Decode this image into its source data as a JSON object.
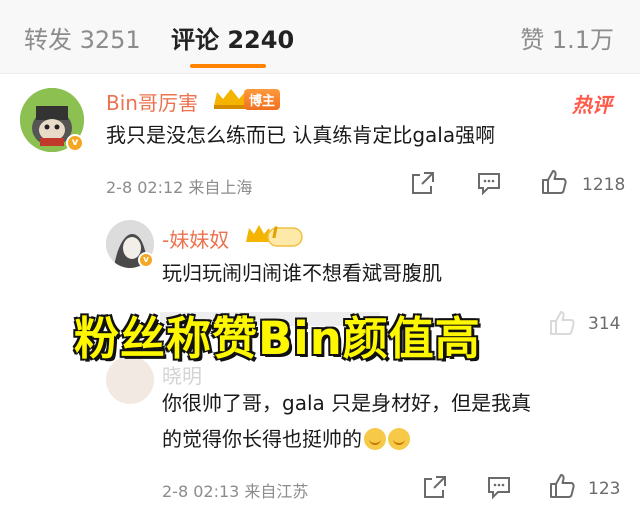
{
  "tabs": {
    "repost": "转发 3251",
    "comment": "评论 2240",
    "like": "赞 1.1万"
  },
  "comments": [
    {
      "user": "Bin哥厉害",
      "host_tag": "博主",
      "hot_tag": "热评",
      "text": "我只是没怎么练而已 认真练肯定比gala强啊",
      "time_location": "2-8 02:12 来自上海",
      "likes": "1218"
    },
    {
      "user": "-妹妹奴",
      "vip_level": "I",
      "text": "玩归玩闹归闹谁不想看斌哥腹肌",
      "likes": "314"
    },
    {
      "user": "晓明",
      "text_line1": "你很帅了哥，gala 只是身材好，但是我真",
      "text_line2": "的觉得你长得也挺帅的",
      "time_location": "2-8 02:13 来自江苏",
      "likes": "123"
    }
  ],
  "overlay": {
    "caption": "粉丝称赞Bin颜值高"
  },
  "colors": {
    "accent": "#ff8200",
    "username": "#eb7350",
    "caption_fill": "#fdf700"
  }
}
